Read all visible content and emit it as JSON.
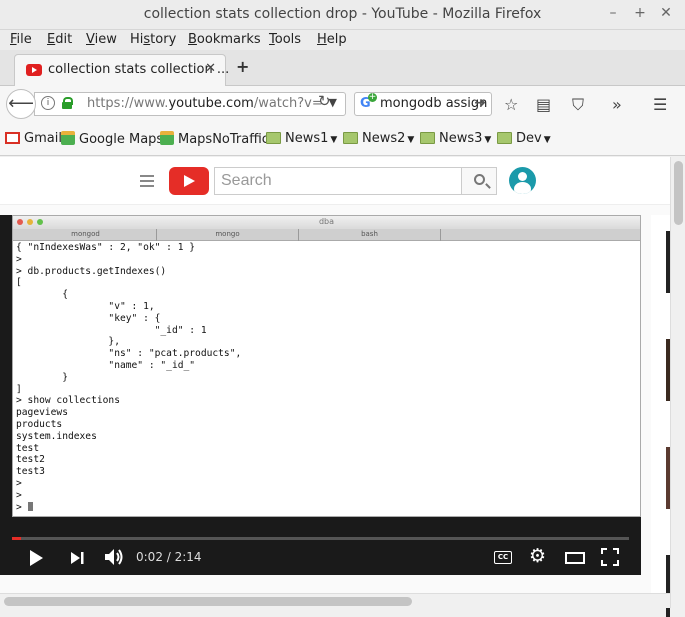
{
  "window": {
    "title": "collection stats collection drop - YouTube - Mozilla Firefox",
    "minimize": "–",
    "maximize": "+",
    "close": "✕"
  },
  "menu": {
    "items": [
      {
        "u": "F",
        "rest": "ile"
      },
      {
        "u": "E",
        "rest": "dit"
      },
      {
        "u": "V",
        "rest": "iew"
      },
      {
        "u": "",
        "rest": "Hi",
        "u2": "s",
        "rest2": "tory"
      },
      {
        "u": "B",
        "rest": "ookmarks"
      },
      {
        "u": "T",
        "rest": "ools"
      },
      {
        "u": "H",
        "rest": "elp"
      }
    ]
  },
  "tab": {
    "label": "collection stats collection ...",
    "close": "✕",
    "new_tab": "+"
  },
  "nav": {
    "url_prefix": "https://www.",
    "url_host": "youtube.com",
    "url_rest": "/watch?v=E",
    "search_query": "mongodb assign"
  },
  "bookmarks": [
    {
      "label": "Gmail",
      "icon": "gmail-icon"
    },
    {
      "label": "Google Maps",
      "icon": "maps-icon"
    },
    {
      "label": "MapsNoTraffic",
      "icon": "maps-icon"
    },
    {
      "label": "News1",
      "icon": "folder-icon"
    },
    {
      "label": "News2",
      "icon": "folder-icon"
    },
    {
      "label": "News3",
      "icon": "folder-icon"
    },
    {
      "label": "Dev",
      "icon": "folder-icon"
    }
  ],
  "youtube": {
    "search_placeholder": "Search"
  },
  "terminal": {
    "window_name": "dba",
    "tabs": [
      "mongod",
      "mongo",
      "bash"
    ],
    "lines": "{ \"nIndexesWas\" : 2, \"ok\" : 1 }\n>\n> db.products.getIndexes()\n[\n        {\n                \"v\" : 1,\n                \"key\" : {\n                        \"_id\" : 1\n                },\n                \"ns\" : \"pcat.products\",\n                \"name\" : \"_id_\"\n        }\n]\n> show collections\npageviews\nproducts\nsystem.indexes\ntest\ntest2\ntest3\n>\n>\n> ",
    "prompt_last": ">"
  },
  "player": {
    "time_current": "0:02",
    "time_total": "2:14",
    "time_display": "0:02 / 2:14",
    "progress_fraction": 0.015,
    "cc_label": "CC"
  }
}
